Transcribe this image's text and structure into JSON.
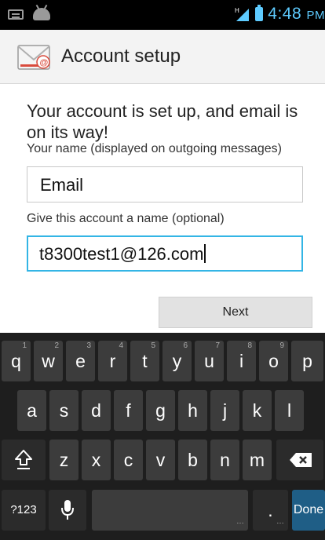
{
  "status_bar": {
    "time": "4:48",
    "ampm": "PM",
    "network_label": "H",
    "icons": [
      "keyboard-icon",
      "android-icon",
      "signal-icon",
      "battery-icon"
    ],
    "clock_color": "#5ecbff"
  },
  "action_bar": {
    "title": "Account setup",
    "icon": "envelope-at-icon"
  },
  "form": {
    "heading": "Your account is set up, and email is on its way!",
    "name_label": "Your name (displayed on outgoing messages)",
    "name_value": "Email",
    "account_label": "Give this account a name (optional)",
    "account_value": "t8300test1@126.com",
    "focus_color": "#33b5e5"
  },
  "next_button": "Next",
  "keyboard": {
    "row1": [
      {
        "k": "q",
        "h": "1"
      },
      {
        "k": "w",
        "h": "2"
      },
      {
        "k": "e",
        "h": "3"
      },
      {
        "k": "r",
        "h": "4"
      },
      {
        "k": "t",
        "h": "5"
      },
      {
        "k": "y",
        "h": "6"
      },
      {
        "k": "u",
        "h": "7"
      },
      {
        "k": "i",
        "h": "8"
      },
      {
        "k": "o",
        "h": "9"
      },
      {
        "k": "p",
        "h": ""
      }
    ],
    "row2": [
      "a",
      "s",
      "d",
      "f",
      "g",
      "h",
      "j",
      "k",
      "l"
    ],
    "row3": [
      "z",
      "x",
      "c",
      "v",
      "b",
      "n",
      "m"
    ],
    "symbols": "?123",
    "period": ".",
    "done": "Done",
    "done_color": "#1f5e86"
  }
}
